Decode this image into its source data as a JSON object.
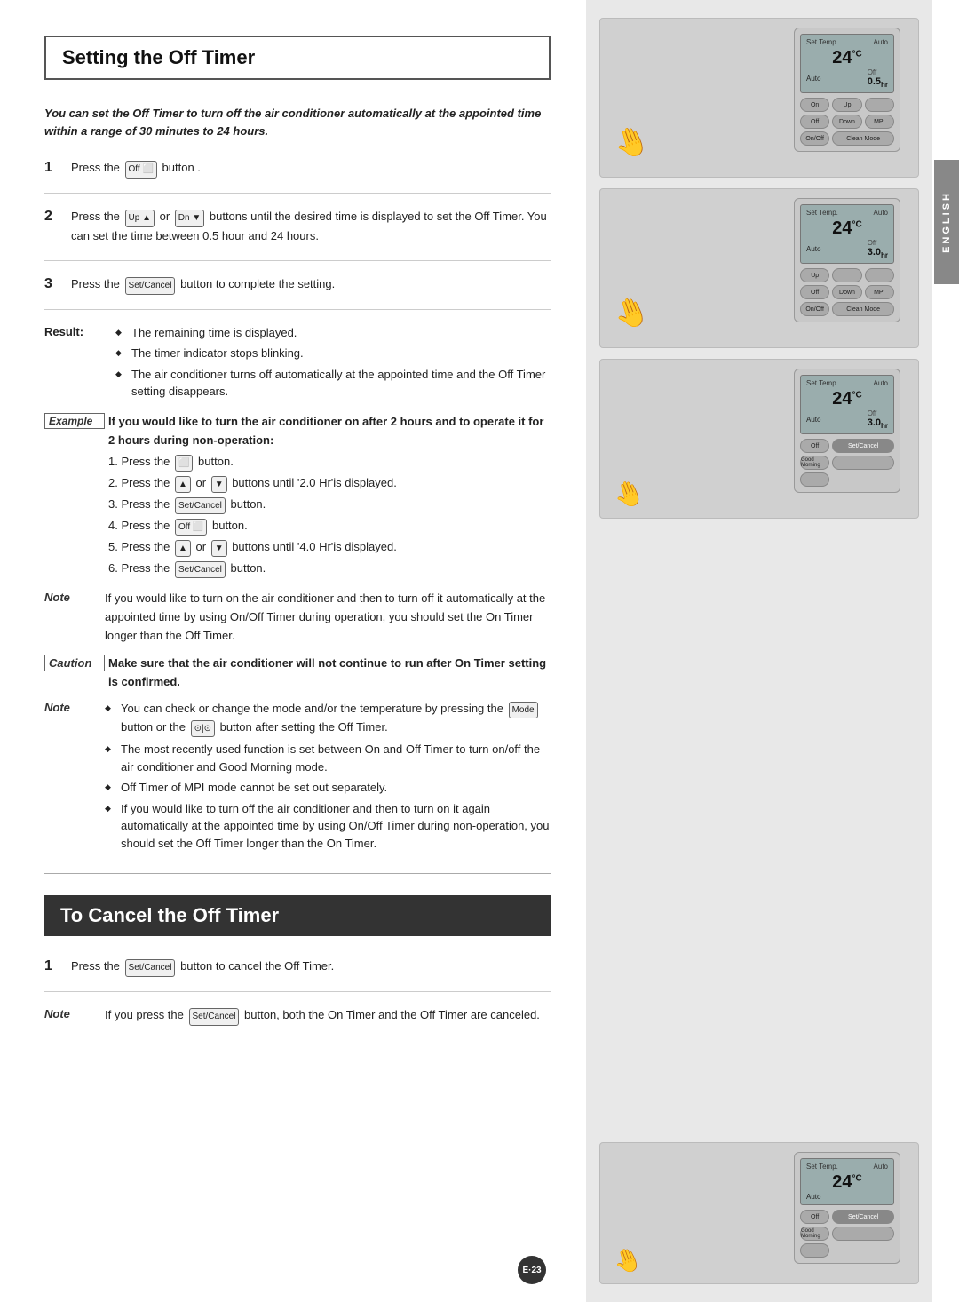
{
  "page": {
    "side_tab": "ENGLISH",
    "page_number": "E·23",
    "section_title": "Setting the Off Timer",
    "cancel_title": "To Cancel the Off Timer",
    "intro": "You can set the Off Timer to turn off the air conditioner automatically at the appointed time within a range of 30 minutes to 24 hours.",
    "steps": [
      {
        "num": "1",
        "text": "Press the  button ."
      },
      {
        "num": "2",
        "text": "Press the  or  buttons until the desired time is displayed to set the Off Timer. You can set the time between 0.5 hour and 24 hours."
      },
      {
        "num": "3",
        "text": "Press the  button to complete the setting."
      }
    ],
    "result_label": "Result:",
    "result_items": [
      "The remaining time is displayed.",
      "The timer indicator stops blinking.",
      "The air conditioner turns off automatically at the appointed time and the Off Timer setting disappears."
    ],
    "example_label": "Example",
    "example_bold": "If you would like to turn the air conditioner on after 2 hours and to operate it for 2 hours during non-operation:",
    "example_steps": [
      "1. Press the  button.",
      "2. Press the  or  buttons until '2.0 Hr'is displayed.",
      "3. Press the  button.",
      "4. Press the  button.",
      "5. Press the  or  buttons until '4.0 Hr'is displayed.",
      "6. Press the  button."
    ],
    "note1_label": "Note",
    "note1_text": "If you would like to turn on the air conditioner and then to turn off it automatically at the appointed time by using On/Off Timer during operation, you should set the On Timer longer than the Off Timer.",
    "caution_label": "Caution",
    "caution_text": "Make sure that the air conditioner will not continue to run after On Timer setting is confirmed.",
    "note2_label": "Note",
    "note2_items": [
      "You can check or change the mode and/or the temperature by pressing the  button or the  button after setting the Off Timer.",
      "The most recently used function is set between On and Off Timer to turn on/off the air conditioner and Good Morning mode.",
      "Off Timer of MPI mode cannot be set out separately.",
      "If you would like to turn off the air conditioner and then to turn on it again automatically at the appointed time by using On/Off Timer during non-operation, you should set the Off Timer longer than the On Timer."
    ],
    "cancel_step1": "Press the  button to cancel the Off Timer.",
    "cancel_note_label": "Note",
    "cancel_note_text": "If you press the  button, both the On Timer and the Off Timer are canceled.",
    "images": [
      {
        "id": "img1",
        "timer_value": "0.5hr",
        "temp": "24"
      },
      {
        "id": "img2",
        "timer_value": "3.0hr",
        "temp": "24"
      },
      {
        "id": "img3",
        "timer_value": "3.0hr",
        "temp": "24"
      },
      {
        "id": "img4",
        "timer_value": "",
        "temp": "24"
      }
    ]
  }
}
